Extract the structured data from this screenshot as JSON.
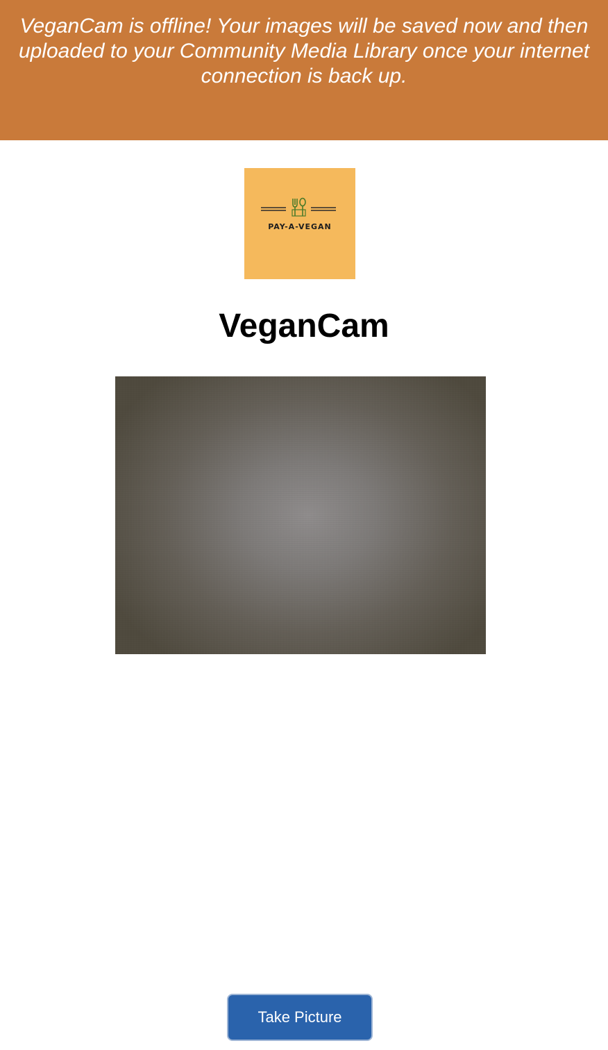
{
  "banner": {
    "message": "VeganCam is offline! Your images will be saved now and then uploaded to your Community Media Library once your internet connection is back up.",
    "color": "#c97a3a"
  },
  "logo": {
    "wordmark": "PAY-A-VEGAN",
    "icon": "fork-and-spoon-icon",
    "background_color": "#f5b95c",
    "icon_color": "#4a7a2a"
  },
  "app": {
    "title": "VeganCam"
  },
  "camera": {
    "state": "live-preview"
  },
  "actions": {
    "take_picture_label": "Take Picture",
    "button_color": "#2a63ac"
  }
}
